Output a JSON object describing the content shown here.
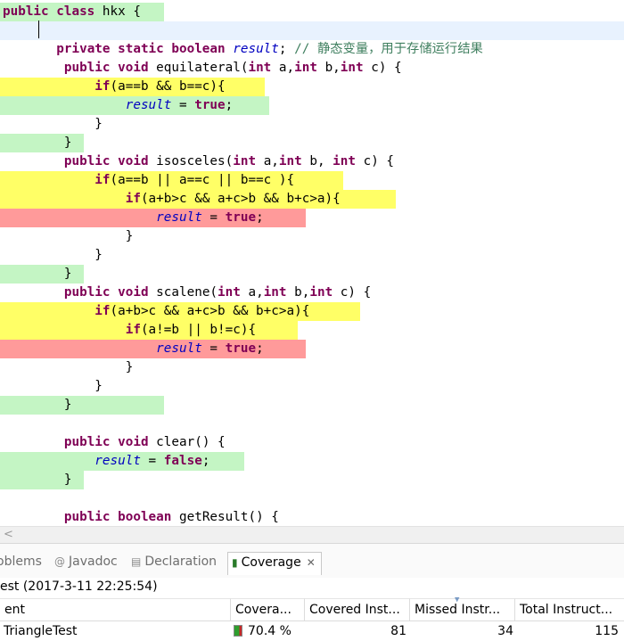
{
  "editor": {
    "colors": {
      "covered": "#c4f5c4",
      "partial": "#ffff66",
      "missed": "#ff9a9a",
      "current_line": "#e8f2fe"
    },
    "lines": [
      {
        "indent": "",
        "hl": "covered",
        "hl_width": 184,
        "tokens": [
          [
            "k",
            "public class "
          ],
          [
            "t",
            "hkx {"
          ]
        ]
      },
      {
        "indent": "",
        "hl": "current",
        "hl_width": 700,
        "tokens": []
      },
      {
        "indent": "       ",
        "hl": "",
        "hl_width": 0,
        "tokens": [
          [
            "k",
            "private static boolean "
          ],
          [
            "f",
            "result"
          ],
          [
            "t",
            "; "
          ],
          [
            "c",
            "// 静态变量，用于存储运行结果"
          ]
        ]
      },
      {
        "indent": "        ",
        "hl": "",
        "hl_width": 0,
        "tokens": [
          [
            "k",
            "public void "
          ],
          [
            "t",
            "equilateral("
          ],
          [
            "k",
            "int "
          ],
          [
            "t",
            "a,"
          ],
          [
            "k",
            "int "
          ],
          [
            "t",
            "b,"
          ],
          [
            "k",
            "int "
          ],
          [
            "t",
            "c) {"
          ]
        ]
      },
      {
        "indent": "            ",
        "hl": "partial",
        "hl_width": 297,
        "tokens": [
          [
            "k",
            "if"
          ],
          [
            "t",
            "(a==b && b==c){"
          ]
        ]
      },
      {
        "indent": "                ",
        "hl": "covered",
        "hl_width": 302,
        "tokens": [
          [
            "f",
            "result"
          ],
          [
            "t",
            " = "
          ],
          [
            "k",
            "true"
          ],
          [
            "t",
            ";"
          ]
        ]
      },
      {
        "indent": "            ",
        "hl": "",
        "hl_width": 0,
        "tokens": [
          [
            "t",
            "}"
          ]
        ]
      },
      {
        "indent": "        ",
        "hl": "covered",
        "hl_width": 94,
        "tokens": [
          [
            "t",
            "}"
          ]
        ]
      },
      {
        "indent": "        ",
        "hl": "",
        "hl_width": 0,
        "tokens": [
          [
            "k",
            "public void "
          ],
          [
            "t",
            "isosceles("
          ],
          [
            "k",
            "int "
          ],
          [
            "t",
            "a,"
          ],
          [
            "k",
            "int "
          ],
          [
            "t",
            "b, "
          ],
          [
            "k",
            "int "
          ],
          [
            "t",
            "c) {"
          ]
        ]
      },
      {
        "indent": "            ",
        "hl": "partial",
        "hl_width": 385,
        "tokens": [
          [
            "k",
            "if"
          ],
          [
            "t",
            "(a==b || a==c || b==c ){"
          ]
        ]
      },
      {
        "indent": "                ",
        "hl": "partial",
        "hl_width": 444,
        "tokens": [
          [
            "k",
            "if"
          ],
          [
            "t",
            "(a+b>c && a+c>b && b+c>a){"
          ]
        ]
      },
      {
        "indent": "                    ",
        "hl": "missed",
        "hl_width": 343,
        "tokens": [
          [
            "f",
            "result"
          ],
          [
            "t",
            " = "
          ],
          [
            "k",
            "true"
          ],
          [
            "t",
            ";"
          ]
        ]
      },
      {
        "indent": "                ",
        "hl": "",
        "hl_width": 0,
        "tokens": [
          [
            "t",
            "}"
          ]
        ]
      },
      {
        "indent": "            ",
        "hl": "",
        "hl_width": 0,
        "tokens": [
          [
            "t",
            "}"
          ]
        ]
      },
      {
        "indent": "        ",
        "hl": "covered",
        "hl_width": 94,
        "tokens": [
          [
            "t",
            "}"
          ]
        ]
      },
      {
        "indent": "        ",
        "hl": "",
        "hl_width": 0,
        "tokens": [
          [
            "k",
            "public void "
          ],
          [
            "t",
            "scalene("
          ],
          [
            "k",
            "int "
          ],
          [
            "t",
            "a,"
          ],
          [
            "k",
            "int "
          ],
          [
            "t",
            "b,"
          ],
          [
            "k",
            "int "
          ],
          [
            "t",
            "c) {"
          ]
        ]
      },
      {
        "indent": "            ",
        "hl": "partial",
        "hl_width": 404,
        "tokens": [
          [
            "k",
            "if"
          ],
          [
            "t",
            "(a+b>c && a+c>b && b+c>a){"
          ]
        ]
      },
      {
        "indent": "                ",
        "hl": "partial",
        "hl_width": 334,
        "tokens": [
          [
            "k",
            "if"
          ],
          [
            "t",
            "(a!=b || b!=c){"
          ]
        ]
      },
      {
        "indent": "                    ",
        "hl": "missed",
        "hl_width": 343,
        "tokens": [
          [
            "f",
            "result"
          ],
          [
            "t",
            " = "
          ],
          [
            "k",
            "true"
          ],
          [
            "t",
            ";"
          ]
        ]
      },
      {
        "indent": "                ",
        "hl": "",
        "hl_width": 0,
        "tokens": [
          [
            "t",
            "}"
          ]
        ]
      },
      {
        "indent": "            ",
        "hl": "",
        "hl_width": 0,
        "tokens": [
          [
            "t",
            "}"
          ]
        ]
      },
      {
        "indent": "        ",
        "hl": "covered",
        "hl_width": 184,
        "tokens": [
          [
            "t",
            "}"
          ]
        ]
      },
      {
        "indent": "",
        "hl": "",
        "hl_width": 0,
        "tokens": []
      },
      {
        "indent": "        ",
        "hl": "",
        "hl_width": 0,
        "tokens": [
          [
            "k",
            "public void "
          ],
          [
            "t",
            "clear() {"
          ]
        ]
      },
      {
        "indent": "            ",
        "hl": "covered",
        "hl_width": 274,
        "tokens": [
          [
            "f",
            "result"
          ],
          [
            "t",
            " = "
          ],
          [
            "k",
            "false"
          ],
          [
            "t",
            ";"
          ]
        ]
      },
      {
        "indent": "        ",
        "hl": "covered",
        "hl_width": 94,
        "tokens": [
          [
            "t",
            "}"
          ]
        ]
      },
      {
        "indent": "",
        "hl": "",
        "hl_width": 0,
        "tokens": []
      },
      {
        "indent": "        ",
        "hl": "",
        "hl_width": 0,
        "tokens": [
          [
            "k",
            "public boolean "
          ],
          [
            "t",
            "getResult() {"
          ]
        ]
      }
    ]
  },
  "scrollbar": {
    "left_arrow": "<"
  },
  "tabs": {
    "problems": "oblems",
    "javadoc": "Javadoc",
    "declaration": "Declaration",
    "coverage": "Coverage",
    "close": "✕",
    "javadoc_icon": "@",
    "declaration_icon": "▤",
    "coverage_icon": "▮"
  },
  "coverage": {
    "session": "est (2017-3-11 22:25:54)",
    "columns": [
      "ent",
      "Covera...",
      "Covered Inst...",
      "Missed Instr...",
      "Total Instruct..."
    ],
    "rows": [
      {
        "element": "TriangleTest",
        "coverage": "70.4 %",
        "covered": "81",
        "missed": "34",
        "total": "115",
        "coverage_fraction": 0.704
      }
    ]
  }
}
